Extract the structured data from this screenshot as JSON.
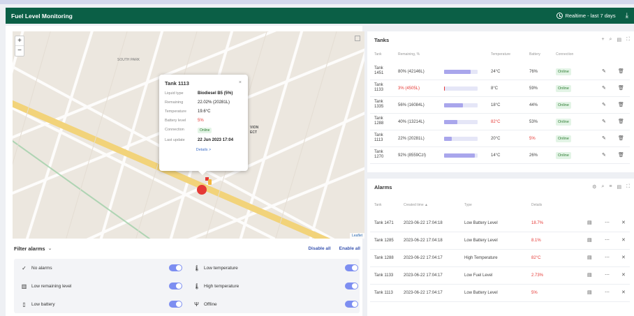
{
  "header": {
    "title": "Fuel Level Monitoring",
    "realtime_label": "Realtime - last 7 days"
  },
  "map": {
    "zoom_in": "+",
    "zoom_out": "−",
    "attribution": "Leaflet",
    "street_labels": [
      "SOUTH PARK",
      "VION",
      "ECT"
    ],
    "popup": {
      "title": "Tank 1113",
      "close": "×",
      "rows": [
        {
          "label": "Liquid type",
          "value": "Biodiesel B5 (5%)"
        },
        {
          "label": "Remaining",
          "value": "22.02% (20281L)"
        },
        {
          "label": "Temperature",
          "value": "19.6°C"
        },
        {
          "label": "Battery level",
          "value": "5%"
        },
        {
          "label": "Connection",
          "value": "Online"
        },
        {
          "label": "Last update",
          "value": "22 Jun 2023 17:04"
        }
      ],
      "details_link": "Details >"
    }
  },
  "filters": {
    "title": "Filter alarms",
    "disable_all": "Disable all",
    "enable_all": "Enable all",
    "items": [
      {
        "label": "No alarms",
        "icon": "check-icon",
        "enabled": true
      },
      {
        "label": "Low temperature",
        "icon": "thermometer-low-icon",
        "enabled": true
      },
      {
        "label": "Low remaining level",
        "icon": "fuel-level-icon",
        "enabled": true
      },
      {
        "label": "High temperature",
        "icon": "thermometer-high-icon",
        "enabled": true
      },
      {
        "label": "Low battery",
        "icon": "battery-icon",
        "enabled": true
      },
      {
        "label": "Offline",
        "icon": "antenna-icon",
        "enabled": true
      }
    ]
  },
  "tanks": {
    "title": "Tanks",
    "columns": [
      "Tank",
      "Remaining, %",
      "Temperature",
      "Battery",
      "Connection"
    ],
    "rows": [
      {
        "tank": "Tank 1451",
        "remaining": "80% (42146L)",
        "fraction": 0.8,
        "temperature": "24°C",
        "battery": "76%",
        "connection": "Online",
        "remaining_alert": false,
        "temp_alert": false,
        "battery_alert": false
      },
      {
        "tank": "Tank 1133",
        "remaining": "3% (4505L)",
        "fraction": 0.03,
        "temperature": "8°C",
        "battery": "59%",
        "connection": "Online",
        "remaining_alert": true,
        "temp_alert": false,
        "battery_alert": false
      },
      {
        "tank": "Tank 1335",
        "remaining": "56% (16084L)",
        "fraction": 0.56,
        "temperature": "18°C",
        "battery": "44%",
        "connection": "Online",
        "remaining_alert": false,
        "temp_alert": false,
        "battery_alert": false
      },
      {
        "tank": "Tank 1288",
        "remaining": "40% (13214L)",
        "fraction": 0.4,
        "temperature": "82°C",
        "battery": "53%",
        "connection": "Online",
        "remaining_alert": false,
        "temp_alert": true,
        "battery_alert": false
      },
      {
        "tank": "Tank 1113",
        "remaining": "22% (20281L)",
        "fraction": 0.22,
        "temperature": "20°C",
        "battery": "5%",
        "connection": "Online",
        "remaining_alert": false,
        "temp_alert": false,
        "battery_alert": true
      },
      {
        "tank": "Tank 1270",
        "remaining": "92% (8559CzI)",
        "fraction": 0.92,
        "temperature": "14°C",
        "battery": "26%",
        "connection": "Online",
        "remaining_alert": false,
        "temp_alert": false,
        "battery_alert": false
      }
    ]
  },
  "alarms": {
    "title": "Alarms",
    "columns": [
      "Tank",
      "Created time",
      "Type",
      "Details"
    ],
    "sort_indicator": "▲",
    "rows": [
      {
        "tank": "Tank 1471",
        "created": "2023-06-22 17:04:18",
        "type": "Low Battery Level",
        "details": "18.7%"
      },
      {
        "tank": "Tank 1285",
        "created": "2023-06-22 17:04:18",
        "type": "Low Battery Level",
        "details": "8.1%"
      },
      {
        "tank": "Tank 1288",
        "created": "2023-06-22 17:04:17",
        "type": "High Temperature",
        "details": "82°C"
      },
      {
        "tank": "Tank 1133",
        "created": "2023-06-22 17:04:17",
        "type": "Low Fuel Level",
        "details": "2.73%"
      },
      {
        "tank": "Tank 1113",
        "created": "2023-06-22 17:04:17",
        "type": "Low Battery Level",
        "details": "5%"
      }
    ]
  },
  "colors": {
    "header_bg": "#0b5f46",
    "accent": "#7d8ef1",
    "alert": "#e53935",
    "online_bg": "#e3f4e6",
    "online_text": "#2e7d32",
    "bar_fill": "#a9a6ec"
  }
}
